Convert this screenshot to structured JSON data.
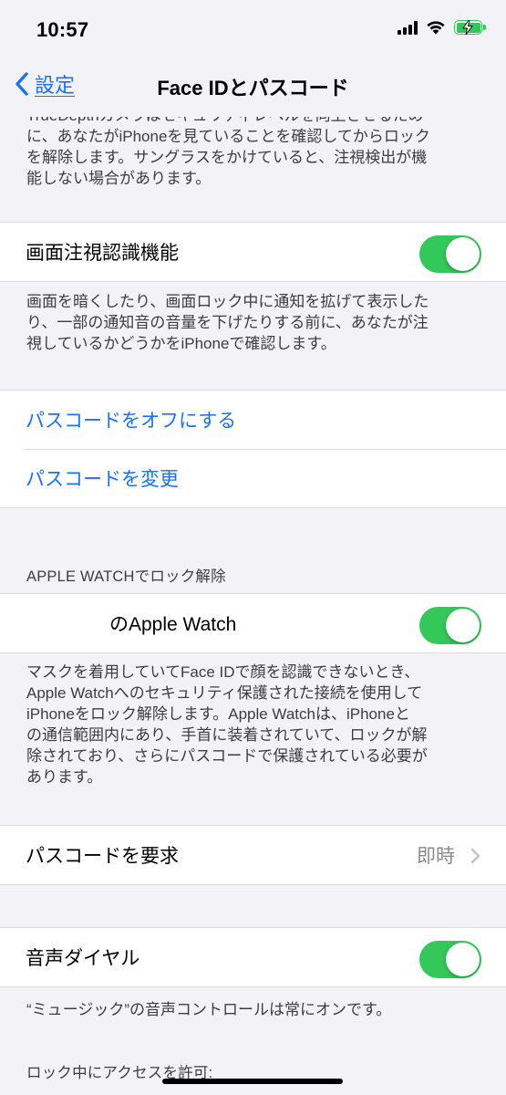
{
  "status_bar": {
    "time": "10:57",
    "battery_color": "#34c759",
    "icons": [
      "cellular-signal-icon",
      "wifi-icon",
      "battery-charging-icon"
    ]
  },
  "nav": {
    "back_label": "設定",
    "title": "Face IDとパスコード",
    "accent_color": "#1a73e8"
  },
  "top_footer": {
    "lines": [
      "TrueDepthカメラはセキュリティレベルを向上させるため",
      "に、あなたがiPhoneを見ていることを確認してからロック",
      "を解除します。サングラスをかけていると、注視検出が機",
      "能しない場合があります。"
    ]
  },
  "attention_aware": {
    "label": "画面注視認識機能",
    "enabled": true,
    "footer_lines": [
      "画面を暗くしたり、画面ロック中に通知を拡げて表示した",
      "り、一部の通知音の音量を下げたりする前に、あなたが注",
      "視しているかどうかをiPhoneで確認します。"
    ]
  },
  "passcode_actions": {
    "turn_off": "パスコードをオフにする",
    "change": "パスコードを変更"
  },
  "apple_watch": {
    "header": "APPLE WATCHでロック解除",
    "device_label": "のApple Watch",
    "enabled": true,
    "footer_lines": [
      "マスクを着用していてFace IDで顔を認識できないとき、",
      "Apple Watchへのセキュリティ保護された接続を使用して",
      "iPhoneをロック解除します。Apple Watchは、iPhoneと",
      "の通信範囲内にあり、手首に装着されていて、ロックが解",
      "除されており、さらにパスコードで保護されている必要が",
      "あります。"
    ]
  },
  "require_passcode": {
    "label": "パスコードを要求",
    "value": "即時"
  },
  "voice_dial": {
    "label": "音声ダイヤル",
    "enabled": true,
    "footer": "“ミュージック”の音声コントロールは常にオンです。"
  },
  "locked_access": {
    "header": "ロック中にアクセスを許可:"
  }
}
